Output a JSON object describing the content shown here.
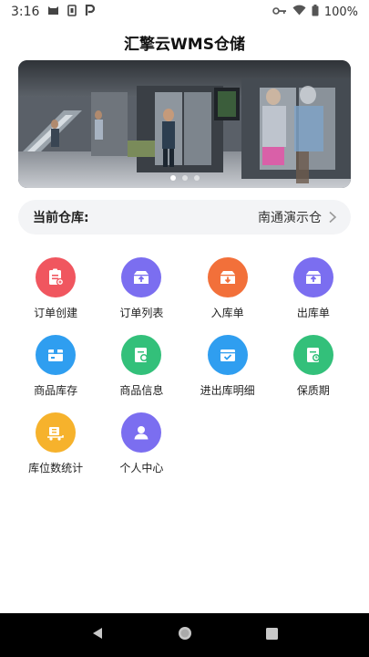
{
  "status_bar": {
    "time": "3:16",
    "battery_text": "100%"
  },
  "app": {
    "title": "汇擎云WMS仓储"
  },
  "banner": {
    "slide_count": 3,
    "active_slide": 1
  },
  "warehouse": {
    "label": "当前仓库:",
    "value": "南通演示仓"
  },
  "menu": [
    {
      "label": "订单创建",
      "icon": "order-create-icon",
      "color": "#f0565f"
    },
    {
      "label": "订单列表",
      "icon": "order-list-icon",
      "color": "#7b6ef0"
    },
    {
      "label": "入库单",
      "icon": "inbound-icon",
      "color": "#f2703a"
    },
    {
      "label": "出库单",
      "icon": "outbound-icon",
      "color": "#7b6ef0"
    },
    {
      "label": "商品库存",
      "icon": "inventory-icon",
      "color": "#2f9ef0"
    },
    {
      "label": "商品信息",
      "icon": "product-info-icon",
      "color": "#33c07a"
    },
    {
      "label": "进出库明细",
      "icon": "in-out-detail-icon",
      "color": "#2f9ef0"
    },
    {
      "label": "保质期",
      "icon": "shelf-life-icon",
      "color": "#33c07a"
    },
    {
      "label": "库位数统计",
      "icon": "location-stats-icon",
      "color": "#f6b22c"
    },
    {
      "label": "个人中心",
      "icon": "profile-icon",
      "color": "#7b6ef0"
    }
  ]
}
